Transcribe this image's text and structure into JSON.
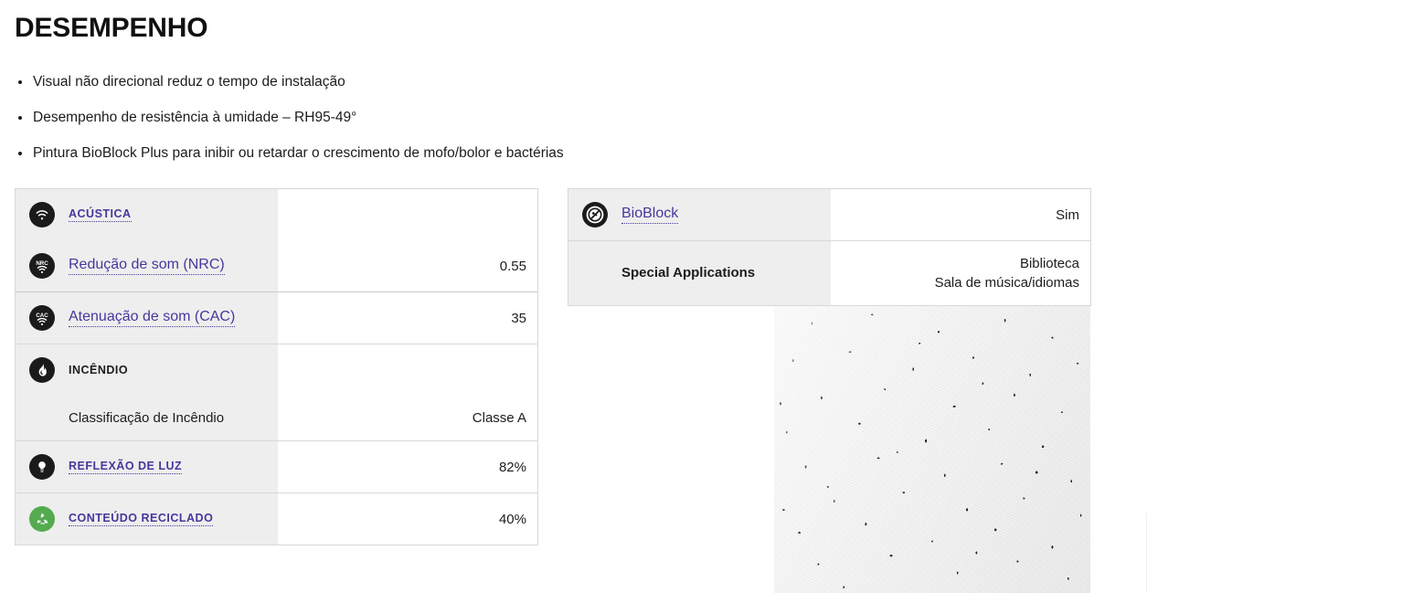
{
  "heading": "DESEMPENHO",
  "bullets": [
    "Visual não direcional reduz o tempo de instalação",
    "Desempenho de resistência à umidade – RH95-49°",
    "Pintura BioBlock Plus para inibir ou retardar o crescimento de mofo/bolor e bactérias"
  ],
  "colors": {
    "link": "#45389C",
    "icon_dark": "#1B1B1B",
    "icon_green": "#54AB4F",
    "label_cell_bg": "#EEEEEE",
    "table_border": "#D8D8D8"
  },
  "left_table": {
    "groups": [
      {
        "rows": [
          {
            "icon": "acoustic-waves-icon",
            "icon_color": "dark",
            "label": "ACÚSTICA",
            "is_link": true,
            "is_heading": true,
            "value": ""
          },
          {
            "icon": "nrc-waves-icon",
            "icon_color": "dark",
            "label": "Redução de som (NRC)",
            "is_link": true,
            "is_heading": false,
            "value": "0.55"
          },
          {
            "icon": "cac-waves-icon",
            "icon_color": "dark",
            "label": "Atenuação de som (CAC)",
            "is_link": true,
            "is_heading": false,
            "value": "35",
            "divided": true
          }
        ]
      },
      {
        "rows": [
          {
            "icon": "flame-icon",
            "icon_color": "dark",
            "label": "INCÊNDIO",
            "is_link": false,
            "is_heading": true,
            "value": ""
          },
          {
            "icon": "",
            "icon_color": "",
            "label": "Classificação de Incêndio",
            "is_link": false,
            "is_heading": false,
            "value": "Classe A"
          }
        ]
      },
      {
        "rows": [
          {
            "icon": "lightbulb-icon",
            "icon_color": "dark",
            "label": "REFLEXÃO DE LUZ",
            "is_link": true,
            "is_heading": true,
            "value": "82%"
          }
        ]
      },
      {
        "rows": [
          {
            "icon": "recycle-icon",
            "icon_color": "green",
            "label": "CONTEÚDO RECICLADO",
            "is_link": true,
            "is_heading": true,
            "value": "40%"
          }
        ]
      }
    ]
  },
  "right_table": {
    "groups": [
      {
        "rows": [
          {
            "icon": "bioblock-no-mold-icon",
            "icon_color": "dark",
            "label": "BioBlock",
            "is_link": true,
            "is_heading": false,
            "value": "Sim"
          }
        ]
      },
      {
        "rows": [
          {
            "icon": "",
            "icon_color": "",
            "label": "Special Applications",
            "is_link": false,
            "is_heading": false,
            "is_bold": true,
            "value_lines": [
              "Biblioteca",
              "Sala de música/idiomas"
            ]
          }
        ]
      }
    ]
  },
  "product_image": {
    "alt": "Textura de forro acústico branco com fissuras escuras"
  }
}
